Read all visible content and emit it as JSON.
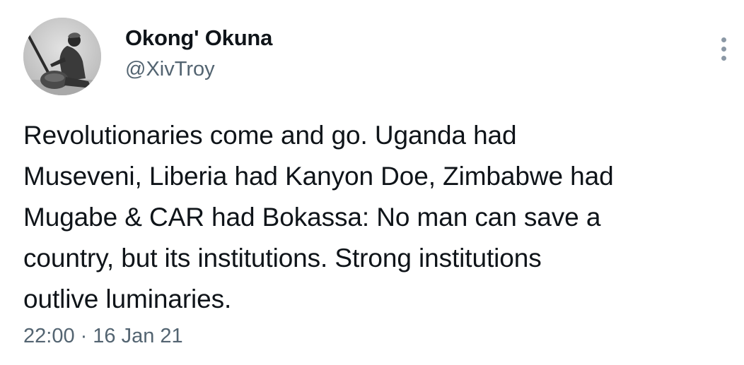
{
  "author": {
    "display_name": "Okong' Okuna",
    "handle": "@XivTroy",
    "avatar_icon": "profile-photo-sepia"
  },
  "tweet": {
    "text_lines": [
      "Revolutionaries come and go. Uganda had",
      "Museveni, Liberia had Kanyon Doe, Zimbabwe had",
      "Mugabe & CAR had Bokassa: No man can save a",
      "country, but its institutions. Strong institutions",
      "outlive luminaries."
    ],
    "time": "22:00",
    "separator": "·",
    "date": "16 Jan 21"
  },
  "menu": {
    "icon": "more-vertical-icon"
  },
  "colors": {
    "primary_text": "#0f1419",
    "secondary_text": "#536471",
    "icon": "#8b98a5",
    "background": "#ffffff"
  }
}
